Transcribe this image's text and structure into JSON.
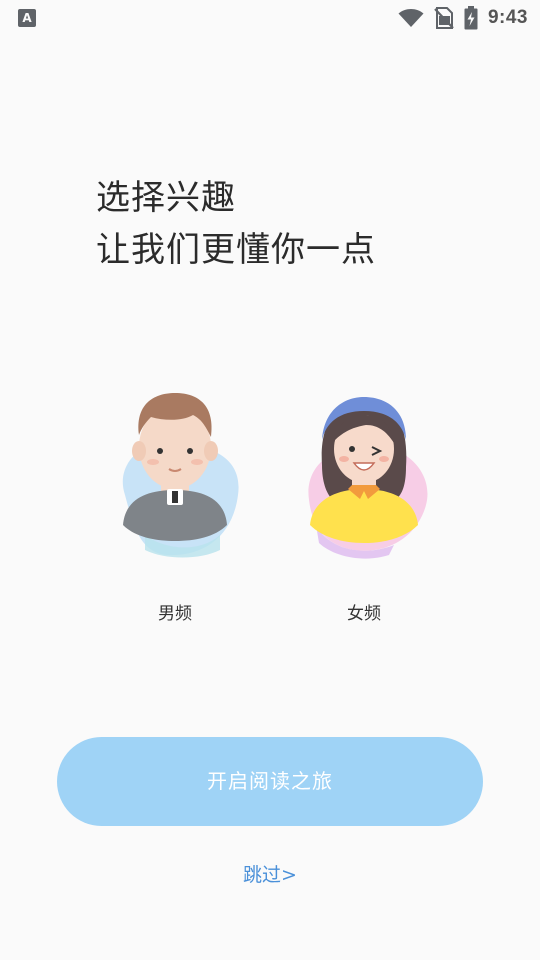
{
  "status_bar": {
    "left_badge": "A",
    "time": "9:43",
    "icons": [
      "wifi-icon",
      "no-sim-icon",
      "battery-charging-icon"
    ]
  },
  "title": {
    "line1": "选择兴趣",
    "line2": "让我们更懂你一点"
  },
  "options": {
    "male_label": "男频",
    "female_label": "女频"
  },
  "start_button_label": "开启阅读之旅",
  "skip_label": "跳过>",
  "colors": {
    "background": "#fafafa",
    "button": "#9fd3f6",
    "link": "#4a90d9",
    "text": "#2b2b2b"
  }
}
